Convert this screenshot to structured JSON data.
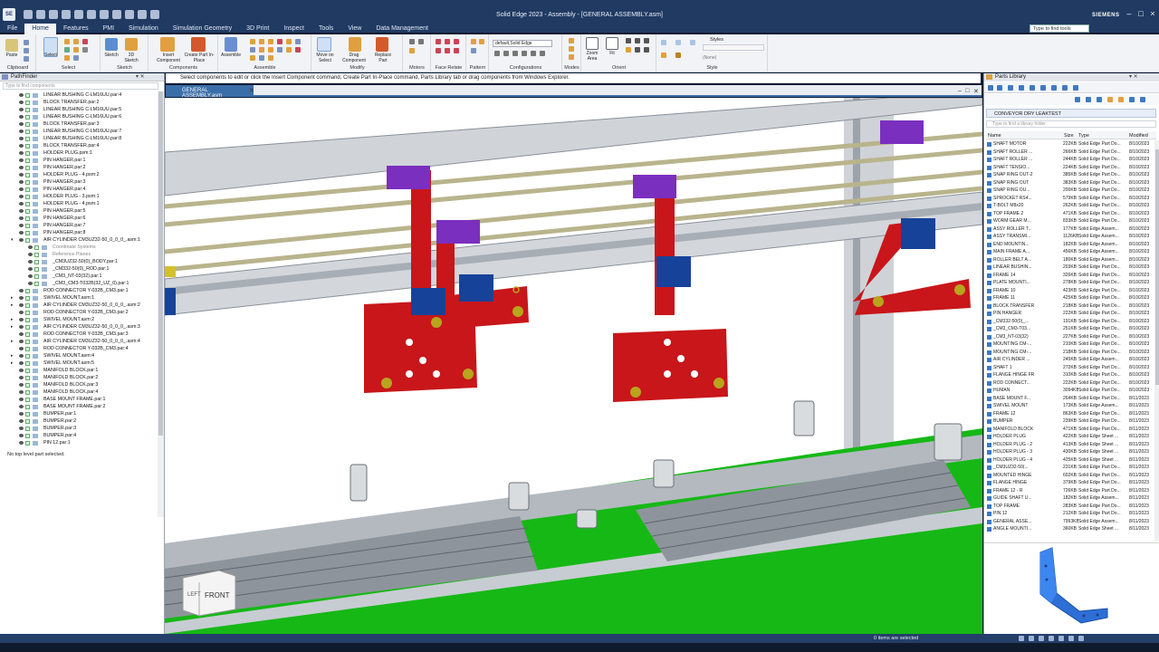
{
  "titlebar": {
    "logo": "SE",
    "title": "Solid Edge 2023 - Assembly - [GENERAL ASSEMBLY.asm]",
    "brand": "SIEMENS",
    "search_placeholder": "Type to find tools"
  },
  "menus": [
    "File",
    "Home",
    "Features",
    "PMI",
    "Simulation",
    "Simulation Geometry",
    "3D Print",
    "Inspect",
    "Tools",
    "View",
    "Data Management"
  ],
  "ribbon": {
    "groups": [
      "Clipboard",
      "Select",
      "Sketch",
      "Components",
      "Assemble",
      "Modify",
      "Motors",
      "Face Relate",
      "Pattern",
      "Configurations",
      "Modes",
      "Orient",
      "Style"
    ],
    "buttons": {
      "paste": "Paste",
      "select": "Select",
      "sketch": "Sketch",
      "sketch3d": "3D Sketch",
      "insert_component": "Insert Component",
      "create_part": "Create Part In-Place",
      "assemble": "Assemble",
      "move_on_select": "Move on Select",
      "drag_component": "Drag Component",
      "replace_part": "Replace Part",
      "zoom_area": "Zoom Area",
      "fit": "Fit",
      "styles": "Styles"
    },
    "config_value": "default,Solid Edge",
    "style_value": "(None)"
  },
  "prompt": "Select components to edit or click the Insert Component command, Create Part In-Place command, Parts Library tab or drag components from Windows Explorer.",
  "pathfinder": {
    "title": "PathFinder",
    "filter_placeholder": "Type to find components",
    "status": "No top level part selected.",
    "items": [
      {
        "label": "LINEAR BUSHING C-LM16UU.par:4",
        "level": 0
      },
      {
        "label": "BLOCK TRANSFER.par:2",
        "level": 0
      },
      {
        "label": "LINEAR BUSHING C-LM16UU.par:5",
        "level": 0
      },
      {
        "label": "LINEAR BUSHING C-LM16UU.par:6",
        "level": 0
      },
      {
        "label": "BLOCK TRANSFER.par:3",
        "level": 0
      },
      {
        "label": "LINEAR BUSHING C-LM16UU.par:7",
        "level": 0
      },
      {
        "label": "LINEAR BUSHING C-LM16UU.par:8",
        "level": 0
      },
      {
        "label": "BLOCK TRANSFER.par:4",
        "level": 0
      },
      {
        "label": "HOLDER PLUG.psm:1",
        "level": 0
      },
      {
        "label": "PIN HANGER.par:1",
        "level": 0
      },
      {
        "label": "PIN HANGER.par:2",
        "level": 0
      },
      {
        "label": "HOLDER PLUG - 4.psm:2",
        "level": 0
      },
      {
        "label": "PIN HANGER.par:3",
        "level": 0
      },
      {
        "label": "PIN HANGER.par:4",
        "level": 0
      },
      {
        "label": "HOLDER PLUG - 3.psm:1",
        "level": 0
      },
      {
        "label": "HOLDER PLUG - 4.psm:1",
        "level": 0
      },
      {
        "label": "PIN HANGER.par:5",
        "level": 0
      },
      {
        "label": "PIN HANGER.par:6",
        "level": 0
      },
      {
        "label": "PIN HANGER.par:7",
        "level": 0
      },
      {
        "label": "PIN HANGER.par:8",
        "level": 0
      },
      {
        "label": "AIR CYLINDER CM3UZ32-50_0_0_0_.asm:1",
        "level": 0,
        "expanded": true
      },
      {
        "label": "Coordinate Systems",
        "level": 1,
        "grey": true
      },
      {
        "label": "Reference Planes",
        "level": 1,
        "grey": true
      },
      {
        "label": "_CM3UZ32-50(0)_BODY.par:1",
        "level": 1
      },
      {
        "label": "_CM332-50(0)_ROD.par:1",
        "level": 1
      },
      {
        "label": "_CM3_NT-03(32).par:1",
        "level": 1
      },
      {
        "label": "_CM3_CM3-T032B(32_UZ_0).par:1",
        "level": 1
      },
      {
        "label": "ROD CONNECTOR Y-032B_CM3.par:1",
        "level": 0
      },
      {
        "label": "SWIVEL MOUNT.asm:1",
        "level": 0,
        "collapsed": true
      },
      {
        "label": "AIR CYLINDER CM3UZ32-50_0_0_0_.asm:2",
        "level": 0,
        "collapsed": true
      },
      {
        "label": "ROD CONNECTOR Y-032B_CM3.par:2",
        "level": 0
      },
      {
        "label": "SWIVEL MOUNT.asm:2",
        "level": 0,
        "collapsed": true
      },
      {
        "label": "AIR CYLINDER CM3UZ32-50_0_0_0_.asm:3",
        "level": 0,
        "collapsed": true
      },
      {
        "label": "ROD CONNECTOR Y-032B_CM3.par:3",
        "level": 0
      },
      {
        "label": "AIR CYLINDER CM3UZ32-50_0_0_0_.asm:4",
        "level": 0,
        "collapsed": true
      },
      {
        "label": "ROD CONNECTOR Y-032B_CM3.par:4",
        "level": 0
      },
      {
        "label": "SWIVEL MOUNT.asm:4",
        "level": 0,
        "collapsed": true
      },
      {
        "label": "SWIVEL MOUNT.asm:5",
        "level": 0,
        "collapsed": true
      },
      {
        "label": "MANIFOLD BLOCK.par:1",
        "level": 0
      },
      {
        "label": "MANIFOLD BLOCK.par:2",
        "level": 0
      },
      {
        "label": "MANIFOLD BLOCK.par:3",
        "level": 0
      },
      {
        "label": "MANIFOLD BLOCK.par:4",
        "level": 0
      },
      {
        "label": "BASE MOUNT FRAME.par:1",
        "level": 0
      },
      {
        "label": "BASE MOUNT FRAME.par:2",
        "level": 0
      },
      {
        "label": "BUMPER.par:1",
        "level": 0
      },
      {
        "label": "BUMPER.par:2",
        "level": 0
      },
      {
        "label": "BUMPER.par:3",
        "level": 0
      },
      {
        "label": "BUMPER.par:4",
        "level": 0
      },
      {
        "label": "PIN 12.par:1",
        "level": 0
      }
    ]
  },
  "document_tab": "GENERAL ASSEMBLY.asm",
  "viewcube": {
    "front": "FRONT",
    "left": "LEFT"
  },
  "parts_library": {
    "title": "Parts Library",
    "path": "CONVEYOR DRY LEAKTEST",
    "filter_placeholder": "Type to find a library folder",
    "columns": [
      "Name",
      "Size",
      "Type",
      "Modified"
    ],
    "rows": [
      [
        "SHAFT MOTOR",
        "222KB",
        "Solid Edge Part Do...",
        "8/10/2023"
      ],
      [
        "SHAFT ROLLER ...",
        "266KB",
        "Solid Edge Part Do...",
        "8/10/2023"
      ],
      [
        "SHAFT ROLLER ...",
        "244KB",
        "Solid Edge Part Do...",
        "8/10/2023"
      ],
      [
        "SHAFT TENSIO...",
        "224KB",
        "Solid Edge Part Do...",
        "8/10/2023"
      ],
      [
        "SNAP RING OUT-2",
        "385KB",
        "Solid Edge Part Do...",
        "8/10/2023"
      ],
      [
        "SNAP RING OUT",
        "383KB",
        "Solid Edge Part Do...",
        "8/10/2023"
      ],
      [
        "SNAP RING OU...",
        "200KB",
        "Solid Edge Part Do...",
        "8/10/2023"
      ],
      [
        "SPROCKET RS4...",
        "579KB",
        "Solid Edge Part Do...",
        "8/10/2023"
      ],
      [
        "T-BOLT M8x20",
        "262KB",
        "Solid Edge Part Do...",
        "8/10/2023"
      ],
      [
        "TOP FRAME 2",
        "471KB",
        "Solid Edge Part Do...",
        "8/10/2023"
      ],
      [
        "WORM GEAR M...",
        "833KB",
        "Solid Edge Part Do...",
        "8/10/2023"
      ],
      [
        "ASSY ROLLER T...",
        "177KB",
        "Solid Edge Assem...",
        "8/10/2023"
      ],
      [
        "ASSY TRANSMI...",
        "1126KB",
        "Solid Edge Assem...",
        "8/10/2023"
      ],
      [
        "END MOUNTIN...",
        "182KB",
        "Solid Edge Assem...",
        "8/10/2023"
      ],
      [
        "MAIN FRAME A...",
        "456KB",
        "Solid Edge Assem...",
        "8/10/2023"
      ],
      [
        "ROLLER BELT A...",
        "180KB",
        "Solid Edge Assem...",
        "8/10/2023"
      ],
      [
        "LINEAR BUSHIN...",
        "203KB",
        "Solid Edge Part Do...",
        "8/10/2023"
      ],
      [
        "FRAME 14",
        "326KB",
        "Solid Edge Part Do...",
        "8/10/2023"
      ],
      [
        "PLATE MOUNTI...",
        "278KB",
        "Solid Edge Part Do...",
        "8/10/2023"
      ],
      [
        "FRAME 10",
        "423KB",
        "Solid Edge Part Do...",
        "8/10/2023"
      ],
      [
        "FRAME 11",
        "425KB",
        "Solid Edge Part Do...",
        "8/10/2023"
      ],
      [
        "BLOCK TRANSFER",
        "218KB",
        "Solid Edge Part Do...",
        "8/10/2023"
      ],
      [
        "PIN HANGER",
        "222KB",
        "Solid Edge Part Do...",
        "8/10/2023"
      ],
      [
        "_CM332-50(0)_...",
        "191KB",
        "Solid Edge Part Do...",
        "8/10/2023"
      ],
      [
        "_CM3_CM3-T03...",
        "251KB",
        "Solid Edge Part Do...",
        "8/10/2023"
      ],
      [
        "_CM3_NT-03(32)",
        "227KB",
        "Solid Edge Part Do...",
        "8/10/2023"
      ],
      [
        "MOUNTING CM-...",
        "210KB",
        "Solid Edge Part Do...",
        "8/10/2023"
      ],
      [
        "MOUNTING CM-...",
        "218KB",
        "Solid Edge Part Do...",
        "8/10/2023"
      ],
      [
        "AIR CYLINDER ...",
        "245KB",
        "Solid Edge Assem...",
        "8/10/2023"
      ],
      [
        "SHAFT 1",
        "272KB",
        "Solid Edge Part Do...",
        "8/10/2023"
      ],
      [
        "FLANGE HINGE FR",
        "310KB",
        "Solid Edge Part Do...",
        "8/10/2023"
      ],
      [
        "ROD CONNECT...",
        "222KB",
        "Solid Edge Part Do...",
        "8/10/2023"
      ],
      [
        "HUMAN",
        "3094KB",
        "Solid Edge Part Do...",
        "8/10/2023"
      ],
      [
        "BASE MOUNT F...",
        "264KB",
        "Solid Edge Part Do...",
        "8/11/2023"
      ],
      [
        "SWIVEL MOUNT",
        "173KB",
        "Solid Edge Assem...",
        "8/11/2023"
      ],
      [
        "FRAME 12",
        "863KB",
        "Solid Edge Part Do...",
        "8/11/2023"
      ],
      [
        "BUMPER",
        "239KB",
        "Solid Edge Part Do...",
        "8/11/2023"
      ],
      [
        "MANIFOLD BLOCK",
        "471KB",
        "Solid Edge Part Do...",
        "8/11/2023"
      ],
      [
        "HOLDER PLUG",
        "422KB",
        "Solid Edge Sheet ...",
        "8/11/2023"
      ],
      [
        "HOLDER PLUG - 2",
        "413KB",
        "Solid Edge Sheet ...",
        "8/11/2023"
      ],
      [
        "HOLDER PLUG - 3",
        "430KB",
        "Solid Edge Sheet ...",
        "8/11/2023"
      ],
      [
        "HOLDER PLUG - 4",
        "425KB",
        "Solid Edge Sheet ...",
        "8/11/2023"
      ],
      [
        "_CM3UZ32-50(...",
        "231KB",
        "Solid Edge Part Do...",
        "8/11/2023"
      ],
      [
        "MOUNTED HINGE",
        "692KB",
        "Solid Edge Part Do...",
        "8/11/2023"
      ],
      [
        "FLANGE HINGE",
        "379KB",
        "Solid Edge Part Do...",
        "8/11/2023"
      ],
      [
        "FRAME 12 - R",
        "726KB",
        "Solid Edge Part Do...",
        "8/11/2023"
      ],
      [
        "GUIDE SHAFT U...",
        "182KB",
        "Solid Edge Assem...",
        "8/11/2023"
      ],
      [
        "TOP FRAME",
        "283KB",
        "Solid Edge Part Do...",
        "8/11/2023"
      ],
      [
        "PIN 12",
        "212KB",
        "Solid Edge Part Do...",
        "8/11/2023"
      ],
      [
        "GENERAL ASSE...",
        "7993KB",
        "Solid Edge Assem...",
        "8/11/2023"
      ],
      [
        "ANGLE MOUNTI...",
        "360KB",
        "Solid Edge Sheet ...",
        "8/11/2023"
      ]
    ]
  },
  "status": {
    "items_selected": "0 items are selected"
  },
  "colors": {
    "frame": "#203a62",
    "floor": "#16b816",
    "hanger": "#c8161a",
    "block": "#7b2fbf",
    "bolt": "#b9a41e"
  }
}
